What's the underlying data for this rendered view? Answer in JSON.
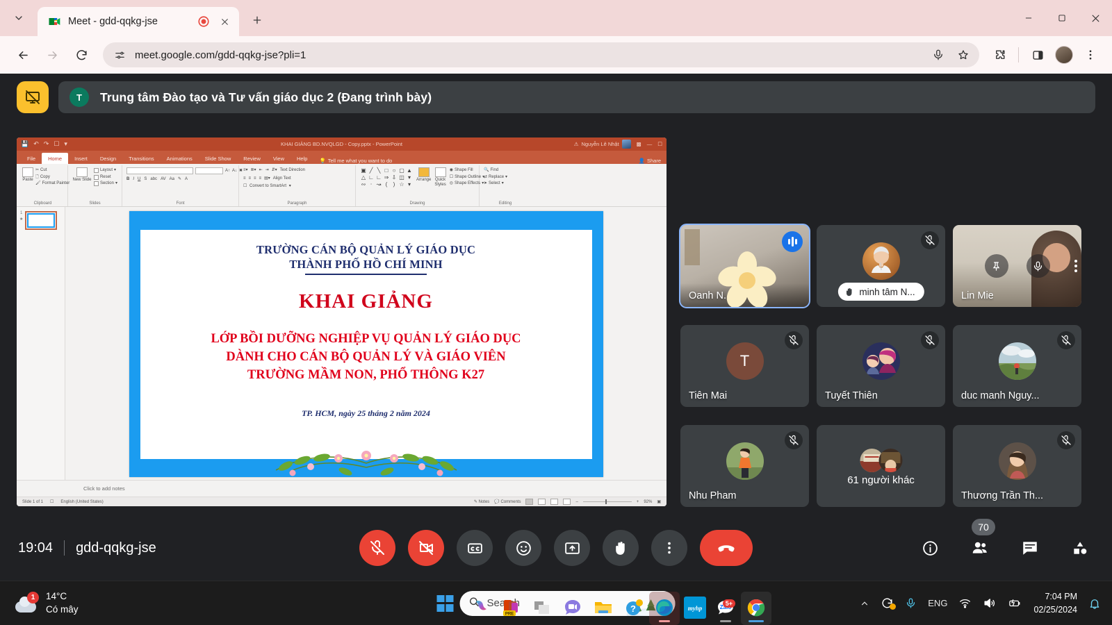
{
  "browser": {
    "tab": {
      "title": "Meet - gdd-qqkg-jse",
      "recording_icon": "record-dot-icon",
      "close_icon": "close-icon"
    },
    "newtab_label": "+",
    "window_controls": {
      "minimize": "–",
      "maximize": "□",
      "close": "✕"
    },
    "toolbar": {
      "back_icon": "back-arrow-icon",
      "forward_icon": "forward-arrow-icon",
      "reload_icon": "reload-icon",
      "site_settings_icon": "tune-icon",
      "url": "meet.google.com/gdd-qqkg-jse?pli=1",
      "mic_icon": "microphone-icon",
      "bookmark_icon": "star-icon",
      "extensions_icon": "puzzle-piece-icon",
      "sidepanel_icon": "side-panel-icon",
      "profile_icon": "profile-avatar",
      "menu_icon": "three-dot-menu-icon"
    }
  },
  "meet": {
    "header": {
      "present_badge_icon": "presentation-stop-icon",
      "presenter_initial": "T",
      "presenter_name": "Trung tâm Đào tạo và Tư vấn giáo dục 2 (Đang trình bày)"
    },
    "powerpoint": {
      "doc_title": "KHAI GIẢNG BD.NVQLGD - Copy.pptx  -  PowerPoint",
      "account_name": "Nguyễn Lê Nhật",
      "quick_access": [
        "save-icon",
        "undo-icon",
        "redo-icon",
        "present-icon",
        "customize-icon"
      ],
      "ribbon_tabs": [
        "File",
        "Home",
        "Insert",
        "Design",
        "Transitions",
        "Animations",
        "Slide Show",
        "Review",
        "View",
        "Help"
      ],
      "active_tab": "Home",
      "tell_me": "Tell me what you want to do",
      "share_label": "Share",
      "groups": [
        {
          "label": "Clipboard",
          "items": [
            "Paste",
            "Cut",
            "Copy",
            "Format Painter"
          ]
        },
        {
          "label": "Slides",
          "items": [
            "New Slide",
            "Layout",
            "Reset",
            "Section"
          ]
        },
        {
          "label": "Font",
          "items": [
            "B",
            "I",
            "U",
            "S",
            "abc",
            "AV",
            "Aa",
            "A"
          ]
        },
        {
          "label": "Paragraph",
          "items": [
            "Text Direction",
            "Align Text",
            "Convert to SmartArt"
          ]
        },
        {
          "label": "Drawing",
          "items": [
            "Arrange",
            "Quick Styles",
            "Shape Fill",
            "Shape Outline",
            "Shape Effects"
          ]
        },
        {
          "label": "Editing",
          "items": [
            "Find",
            "Replace",
            "Select"
          ]
        }
      ],
      "thumbnail_number": "1",
      "notes_placeholder": "Click to add notes",
      "status": {
        "slide_count": "Slide 1 of 1",
        "language": "English (United States)",
        "notes": "Notes",
        "comments": "Comments",
        "zoom": "92%"
      },
      "slide": {
        "org_line1": "TRƯỜNG CÁN BỘ QUẢN LÝ GIÁO DỤC",
        "org_line2": "THÀNH PHỐ HỒ CHÍ MINH",
        "heading": "KHAI GIẢNG",
        "body_line1": "LỚP BỒI DƯỠNG NGHIỆP VỤ QUẢN LÝ GIÁO DỤC",
        "body_line2": "DÀNH CHO CÁN BỘ QUẢN LÝ VÀ GIÁO VIÊN",
        "body_line3": "TRƯỜNG MẦM NON, PHỔ THÔNG K27",
        "date": "TP. HCM, ngày 25 tháng 2 năm 2024"
      }
    },
    "tiles": [
      {
        "name": "Oanh N...ị T...",
        "type": "video",
        "state": "speaking",
        "active": true,
        "speaking_icon": "audio-level-icon",
        "decoration": "flower-sticker"
      },
      {
        "name": "minh tâm N...",
        "type": "avatar",
        "state": "muted",
        "mic_icon": "mic-off-icon",
        "name_style": "pill",
        "pill_icon": "raised-hand-icon"
      },
      {
        "name": "Lin Mie",
        "type": "video",
        "state": "hovered",
        "hover_icons": [
          "pin-icon",
          "mic-off-icon",
          "more-options-icon"
        ]
      },
      {
        "name": "Tiên Mai",
        "type": "initial",
        "initial": "T",
        "state": "muted",
        "mic_icon": "mic-off-icon"
      },
      {
        "name": "Tuyết Thiên",
        "type": "avatar",
        "state": "muted",
        "mic_icon": "mic-off-icon"
      },
      {
        "name": "duc manh Nguy...",
        "type": "avatar",
        "state": "muted",
        "mic_icon": "mic-off-icon"
      },
      {
        "name": "Nhu Pham",
        "type": "avatar",
        "state": "muted",
        "mic_icon": "mic-off-icon"
      },
      {
        "name": "61 người khác",
        "type": "overflow",
        "state": "none"
      },
      {
        "name": "Thương Trần Th...",
        "type": "avatar",
        "state": "muted",
        "mic_icon": "mic-off-icon"
      }
    ],
    "bottom": {
      "time": "19:04",
      "meeting_code": "gdd-qqkg-jse",
      "controls": [
        {
          "name": "microphone-toggle",
          "icon": "mic-off-icon",
          "state": "off"
        },
        {
          "name": "camera-toggle",
          "icon": "video-off-icon",
          "state": "off"
        },
        {
          "name": "captions-toggle",
          "icon": "closed-captions-icon",
          "state": "on"
        },
        {
          "name": "reactions-button",
          "icon": "emoji-icon",
          "state": "on"
        },
        {
          "name": "present-now-button",
          "icon": "present-screen-icon",
          "state": "on"
        },
        {
          "name": "raise-hand-button",
          "icon": "raised-hand-icon",
          "state": "on"
        },
        {
          "name": "more-options-button",
          "icon": "three-dot-menu-icon",
          "state": "on"
        },
        {
          "name": "leave-call-button",
          "icon": "end-call-icon",
          "state": "danger"
        }
      ],
      "right": [
        {
          "name": "meeting-details-button",
          "icon": "info-icon"
        },
        {
          "name": "participants-button",
          "icon": "people-icon",
          "badge": "70"
        },
        {
          "name": "chat-button",
          "icon": "chat-bubble-icon"
        },
        {
          "name": "activities-button",
          "icon": "activities-shapes-icon"
        }
      ]
    }
  },
  "taskbar": {
    "weather": {
      "temp": "14°C",
      "condition": "Có mây",
      "badge": "1",
      "icon": "cloud-icon"
    },
    "start_icon": "windows-logo-icon",
    "search": {
      "placeholder": "Search",
      "icon": "search-icon",
      "art": "winter-trees-art"
    },
    "apps": [
      {
        "name": "copilot-icon"
      },
      {
        "name": "office-pre-icon"
      },
      {
        "name": "task-view-icon"
      },
      {
        "name": "meet-video-icon"
      },
      {
        "name": "file-explorer-icon"
      },
      {
        "name": "help-icon"
      },
      {
        "name": "microsoft-edge-icon",
        "running": true
      },
      {
        "name": "myhp-icon",
        "label": "myhp"
      },
      {
        "name": "zalo-icon",
        "badge": "5+",
        "running": true
      },
      {
        "name": "google-chrome-icon",
        "running": true,
        "active": true
      }
    ],
    "tray": [
      {
        "name": "show-hidden-icons-chevron"
      },
      {
        "name": "onedrive-sync-icon"
      },
      {
        "name": "microphone-icon"
      },
      {
        "name": "language-indicator",
        "label": "ENG"
      },
      {
        "name": "wifi-icon"
      },
      {
        "name": "volume-icon"
      },
      {
        "name": "battery-icon"
      }
    ],
    "clock": {
      "time": "7:04 PM",
      "date": "02/25/2024"
    },
    "notification_icon": "bell-icon"
  }
}
